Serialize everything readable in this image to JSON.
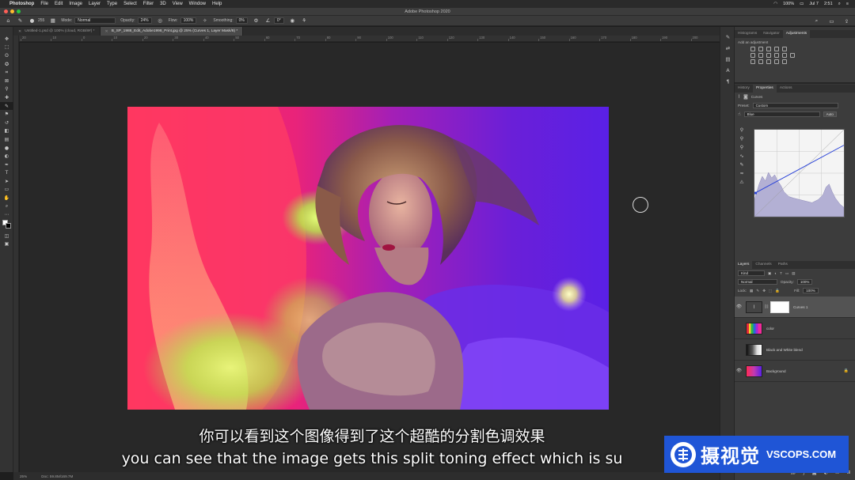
{
  "menubar": {
    "app_name": "Photoshop",
    "items": [
      "File",
      "Edit",
      "Image",
      "Layer",
      "Type",
      "Select",
      "Filter",
      "3D",
      "View",
      "Window",
      "Help"
    ],
    "battery": "100%",
    "date": "Jul 7",
    "time": "2:51"
  },
  "window": {
    "title": "Adobe Photoshop 2020"
  },
  "options": {
    "brush_size": "255",
    "mode_label": "Mode:",
    "mode_value": "Normal",
    "opacity_label": "Opacity:",
    "opacity_value": "24%",
    "flow_label": "Flow:",
    "flow_value": "100%",
    "smoothing_label": "Smoothing:",
    "smoothing_value": "0%",
    "angle_value": "0°"
  },
  "tabs": [
    {
      "label": "Untitled-1.psd @ 100% (cloud, RGB/8#) *"
    },
    {
      "label": "B_SP_1988_Edit_Adobe1998_Print.jpg @ 25% (Curves 1, Layer Mask/8) *"
    }
  ],
  "ruler": {
    "top": [
      "20",
      "10",
      "0",
      "10",
      "20",
      "30",
      "40",
      "50",
      "60",
      "70",
      "80",
      "90",
      "100",
      "110",
      "120",
      "130",
      "140",
      "150",
      "160",
      "170",
      "180",
      "190",
      "200"
    ]
  },
  "status": {
    "zoom": "25%",
    "doc": "Doc: 59.8M/169.7M"
  },
  "subtitles": {
    "zh": "你可以看到这个图像得到了这个超酷的分割色调效果",
    "en": "you can see that the image gets this split toning effect which is su"
  },
  "watermark": {
    "cn": "摄视觉",
    "en": "VSCOPS.COM"
  },
  "adjustments_panel": {
    "tabs": [
      "Histograms",
      "Navigator",
      "Adjustments"
    ],
    "active_tab": 2,
    "add_label": "Add an adjustment"
  },
  "properties_panel": {
    "tabs": [
      "History",
      "Properties",
      "Actions"
    ],
    "active_tab": 1,
    "adjustment_name": "Curves",
    "preset_label": "Preset:",
    "preset_value": "Custom",
    "channel_value": "Blue",
    "auto_label": "Auto",
    "input_label": "Input:",
    "input_value": "0",
    "output_label": "Output:",
    "output_value": "79"
  },
  "layers_panel": {
    "tabs": [
      "Layers",
      "Channels",
      "Paths"
    ],
    "active_tab": 0,
    "kind_label": "Kind",
    "blend_mode": "Normal",
    "opacity_label": "Opacity:",
    "opacity_value": "100%",
    "lock_label": "Lock:",
    "fill_label": "Fill:",
    "fill_value": "100%",
    "layers": [
      {
        "name": "Curves 1",
        "visible": true,
        "selected": true,
        "type": "curves"
      },
      {
        "name": "color",
        "visible": false,
        "selected": false,
        "type": "color"
      },
      {
        "name": "Black and White blend",
        "visible": false,
        "selected": false,
        "type": "bw"
      },
      {
        "name": "Background",
        "visible": true,
        "selected": false,
        "type": "background"
      }
    ]
  },
  "colors": {
    "accent_blue": "#1f55d6",
    "panel": "#3c3c3c",
    "canvas_bg": "#282828"
  }
}
